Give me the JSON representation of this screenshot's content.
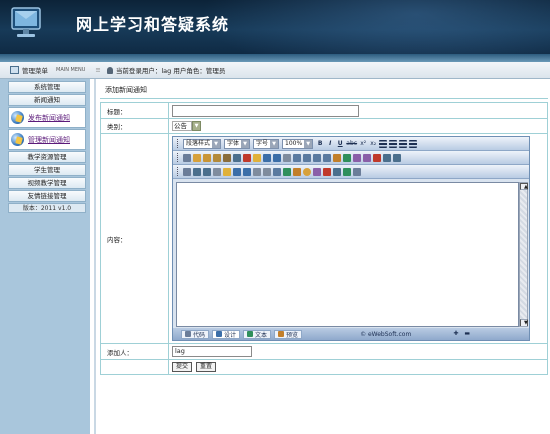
{
  "header": {
    "title": "网上学习和答疑系统"
  },
  "statusbar": {
    "menu_label": "管理菜单",
    "menu_en": "MAIN MENU",
    "separator": "≡",
    "user_text": "当前登录用户：lag   用户角色：管理员"
  },
  "sidebar": {
    "group1": [
      "系统管理",
      "新闻通知"
    ],
    "section1": "发布新闻通知",
    "section2": "管理新闻通知",
    "group2": [
      "教学资源管理",
      "学生管理",
      "视频教学管理",
      "友情链接管理"
    ],
    "version": "版本：2011 v1.0"
  },
  "main": {
    "page_title": "添加新闻通知",
    "rows": {
      "title_label": "标题：",
      "category_label": "类别：",
      "category_value": "公告",
      "content_label": "内容：",
      "adder_label": "添加人：",
      "adder_value": "lag"
    },
    "buttons": {
      "submit": "提交",
      "reset": "重置"
    }
  },
  "editor": {
    "toolbar1": {
      "paragraph_style": "段落样式",
      "font": "字体",
      "font_size": "字号",
      "zoom": "100%",
      "bold": "B",
      "italic": "I",
      "underline": "U",
      "strike": "abc",
      "sup": "x²",
      "sub": "x₂"
    },
    "modes": [
      "代码",
      "设计",
      "文本",
      "预览"
    ],
    "copyright": "© eWebSoft.com",
    "scroll_up": "▲",
    "scroll_down": "▼"
  },
  "colors": {
    "header_bg": "#173a58",
    "sidebar_bg": "#a9c6dc",
    "border": "#9fd0d6",
    "section_link": "#5b1a7a"
  }
}
